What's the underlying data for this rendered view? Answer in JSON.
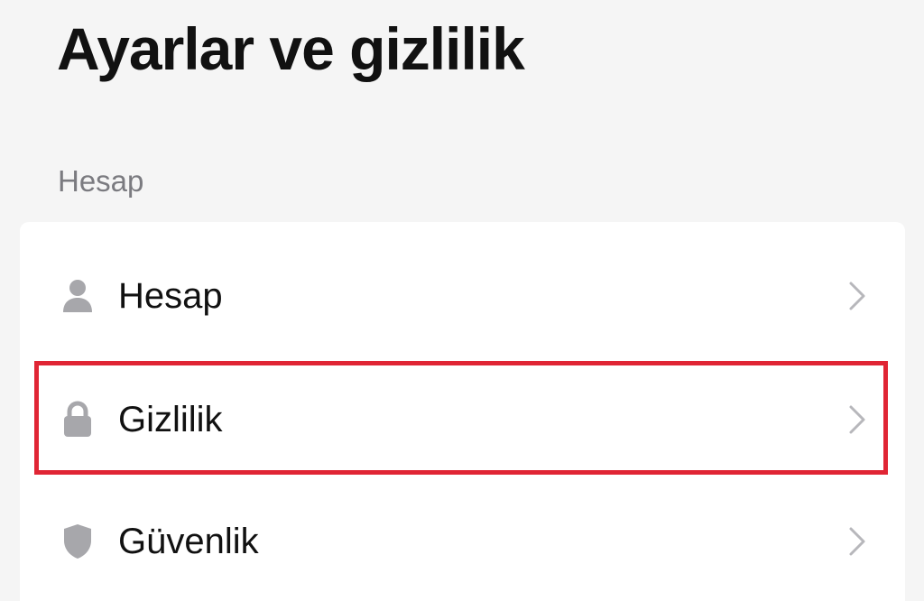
{
  "header": {
    "title": "Ayarlar ve gizlilik"
  },
  "section": {
    "title": "Hesap",
    "items": [
      {
        "label": "Hesap",
        "icon": "person-icon"
      },
      {
        "label": "Gizlilik",
        "icon": "lock-icon",
        "highlighted": true
      },
      {
        "label": "Güvenlik",
        "icon": "shield-icon"
      }
    ]
  },
  "colors": {
    "background": "#f5f5f5",
    "card": "#ffffff",
    "icon_gray": "#a7a7ab",
    "chevron_gray": "#b7b7bb",
    "highlight_red": "#e02534",
    "section_text": "#7b7b80",
    "primary_text": "#111111"
  }
}
